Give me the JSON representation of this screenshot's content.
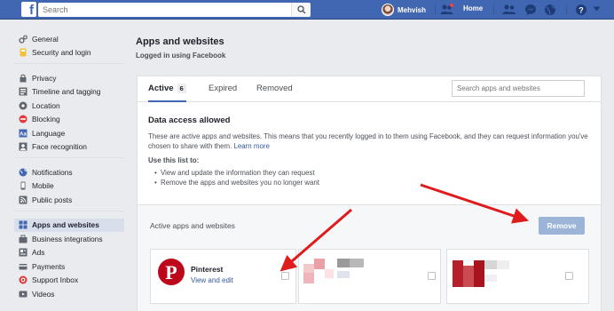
{
  "topbar": {
    "search_placeholder": "Search",
    "user_name": "Mehvish",
    "home_label": "Home"
  },
  "sidebar": {
    "groups": [
      {
        "items": [
          {
            "label": "General",
            "icon": "gears-icon"
          },
          {
            "label": "Security and login",
            "icon": "badge-icon"
          }
        ]
      },
      {
        "items": [
          {
            "label": "Privacy",
            "icon": "lock-icon"
          },
          {
            "label": "Timeline and tagging",
            "icon": "timeline-icon"
          },
          {
            "label": "Location",
            "icon": "location-icon"
          },
          {
            "label": "Blocking",
            "icon": "blocking-icon"
          },
          {
            "label": "Language",
            "icon": "language-icon"
          },
          {
            "label": "Face recognition",
            "icon": "face-recognition-icon"
          }
        ]
      },
      {
        "items": [
          {
            "label": "Notifications",
            "icon": "globe-icon"
          },
          {
            "label": "Mobile",
            "icon": "mobile-icon"
          },
          {
            "label": "Public posts",
            "icon": "rss-icon"
          }
        ]
      },
      {
        "items": [
          {
            "label": "Apps and websites",
            "icon": "apps-icon",
            "active": true
          },
          {
            "label": "Business integrations",
            "icon": "business-icon"
          },
          {
            "label": "Ads",
            "icon": "ads-icon"
          },
          {
            "label": "Payments",
            "icon": "payments-icon"
          },
          {
            "label": "Support Inbox",
            "icon": "support-icon"
          },
          {
            "label": "Videos",
            "icon": "videos-icon"
          }
        ]
      }
    ]
  },
  "main": {
    "title": "Apps and websites",
    "subtitle": "Logged in using Facebook",
    "tabs": [
      {
        "label": "Active",
        "count": "6",
        "active": true
      },
      {
        "label": "Expired"
      },
      {
        "label": "Removed"
      }
    ],
    "search_placeholder": "Search apps and websites",
    "info": {
      "title": "Data access allowed",
      "text": "These are active apps and websites. This means that you recently logged in to them using Facebook, and they can request information you've chosen to share with them.",
      "learn_more": "Learn more",
      "use_title": "Use this list to:",
      "uses": [
        "View and update the information they can request",
        "Remove the apps and websites you no longer want"
      ]
    },
    "active_title": "Active apps and websites",
    "remove_label": "Remove",
    "apps": [
      {
        "name": "Pinterest",
        "link": "View and edit"
      }
    ]
  },
  "colors": {
    "facebook_blue": "#4267b2",
    "link_blue": "#365899",
    "pinterest_red": "#bd081c",
    "arrow_red": "#e01b1b"
  }
}
